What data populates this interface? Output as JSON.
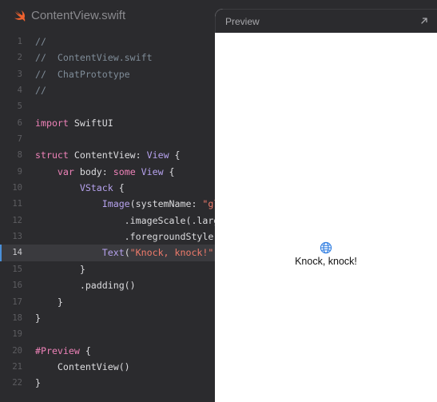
{
  "editor": {
    "file_title": "ContentView.swift",
    "highlighted_line": 14,
    "lines": [
      {
        "num": "1",
        "tokens": [
          {
            "t": "//",
            "c": "comment"
          }
        ]
      },
      {
        "num": "2",
        "tokens": [
          {
            "t": "//  ContentView.swift",
            "c": "comment"
          }
        ]
      },
      {
        "num": "3",
        "tokens": [
          {
            "t": "//  ChatPrototype",
            "c": "comment"
          }
        ]
      },
      {
        "num": "4",
        "tokens": [
          {
            "t": "//",
            "c": "comment"
          }
        ]
      },
      {
        "num": "5",
        "tokens": []
      },
      {
        "num": "6",
        "tokens": [
          {
            "t": "import",
            "c": "kw"
          },
          {
            "t": " SwiftUI",
            "c": "plain"
          }
        ]
      },
      {
        "num": "7",
        "tokens": []
      },
      {
        "num": "8",
        "tokens": [
          {
            "t": "struct",
            "c": "kw"
          },
          {
            "t": " ContentView: ",
            "c": "plain"
          },
          {
            "t": "View",
            "c": "type"
          },
          {
            "t": " {",
            "c": "plain"
          }
        ]
      },
      {
        "num": "9",
        "tokens": [
          {
            "t": "    ",
            "c": "plain"
          },
          {
            "t": "var",
            "c": "kw"
          },
          {
            "t": " body: ",
            "c": "plain"
          },
          {
            "t": "some",
            "c": "kw"
          },
          {
            "t": " ",
            "c": "plain"
          },
          {
            "t": "View",
            "c": "type"
          },
          {
            "t": " {",
            "c": "plain"
          }
        ]
      },
      {
        "num": "10",
        "tokens": [
          {
            "t": "        ",
            "c": "plain"
          },
          {
            "t": "VStack",
            "c": "type"
          },
          {
            "t": " {",
            "c": "plain"
          }
        ]
      },
      {
        "num": "11",
        "tokens": [
          {
            "t": "            ",
            "c": "plain"
          },
          {
            "t": "Image",
            "c": "type"
          },
          {
            "t": "(systemName: ",
            "c": "plain"
          },
          {
            "t": "\"gl",
            "c": "str"
          }
        ]
      },
      {
        "num": "12",
        "tokens": [
          {
            "t": "                .imageScale(.larg",
            "c": "plain"
          }
        ]
      },
      {
        "num": "13",
        "tokens": [
          {
            "t": "                .foregroundStyle(",
            "c": "plain"
          }
        ]
      },
      {
        "num": "14",
        "tokens": [
          {
            "t": "            ",
            "c": "plain"
          },
          {
            "t": "Text",
            "c": "type"
          },
          {
            "t": "(",
            "c": "plain"
          },
          {
            "t": "\"Knock, knock!\"",
            "c": "str"
          },
          {
            "t": ")",
            "c": "plain"
          }
        ]
      },
      {
        "num": "15",
        "tokens": [
          {
            "t": "        }",
            "c": "plain"
          }
        ]
      },
      {
        "num": "16",
        "tokens": [
          {
            "t": "        .padding()",
            "c": "plain"
          }
        ]
      },
      {
        "num": "17",
        "tokens": [
          {
            "t": "    }",
            "c": "plain"
          }
        ]
      },
      {
        "num": "18",
        "tokens": [
          {
            "t": "}",
            "c": "plain"
          }
        ]
      },
      {
        "num": "19",
        "tokens": []
      },
      {
        "num": "20",
        "tokens": [
          {
            "t": "#Preview",
            "c": "kw"
          },
          {
            "t": " {",
            "c": "plain"
          }
        ]
      },
      {
        "num": "21",
        "tokens": [
          {
            "t": "    ContentView()",
            "c": "plain"
          }
        ]
      },
      {
        "num": "22",
        "tokens": [
          {
            "t": "}",
            "c": "plain"
          }
        ]
      }
    ]
  },
  "preview": {
    "title": "Preview",
    "content_text": "Knock, knock!",
    "icons": {
      "expand": "expand-arrow-icon",
      "globe": "globe-icon",
      "file": "swift-icon"
    }
  },
  "colors": {
    "editor_bg": "#2b2b2e",
    "keyword": "#ee82b8",
    "type": "#b6a2ee",
    "string": "#f07b6b",
    "comment": "#7f8c98",
    "swift_orange": "#f0622e",
    "globe_blue": "#2f7de1"
  }
}
